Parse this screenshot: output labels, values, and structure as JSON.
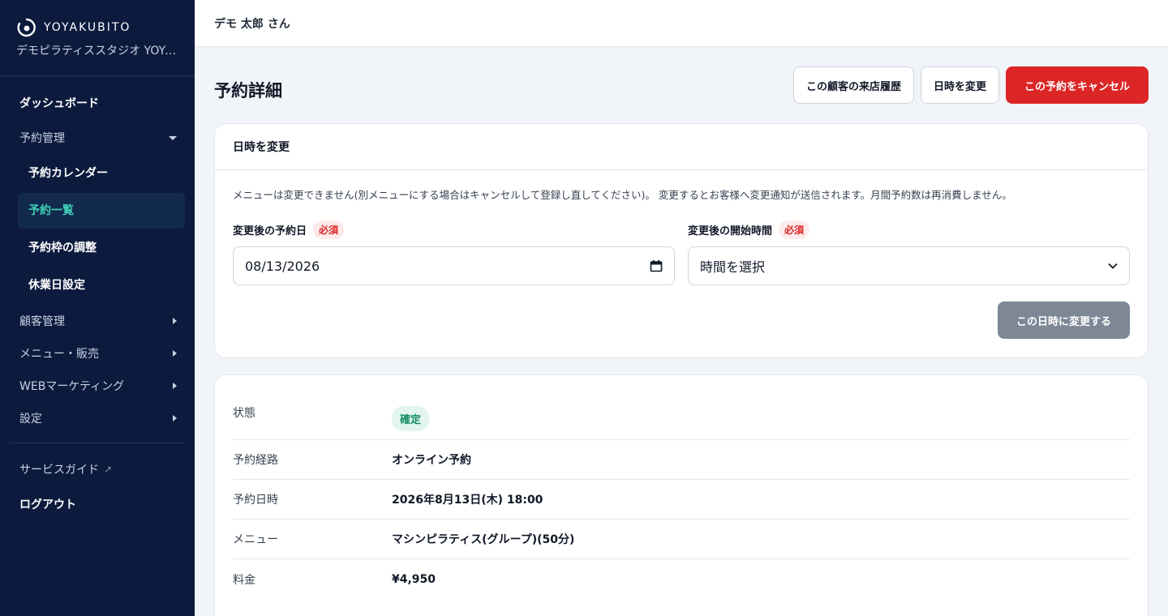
{
  "sidebar": {
    "brand_name": "YOYAKUBITO",
    "studio_name": "デモピラティススタジオ YOYAKUBITO",
    "dashboard": "ダッシュボード",
    "reservation_group": "予約管理",
    "reservation_items": [
      "予約カレンダー",
      "予約一覧",
      "予約枠の調整",
      "休業日設定"
    ],
    "groups": [
      "顧客管理",
      "メニュー・販売",
      "WEBマーケティング",
      "設定"
    ],
    "service_guide": "サービスガイド",
    "logout": "ログアウト"
  },
  "topbar": {
    "user": "デモ 太郎 さん"
  },
  "page": {
    "title": "予約詳細",
    "actions": {
      "history": "この顧客の来店履歴",
      "reschedule": "日時を変更",
      "cancel": "この予約をキャンセル"
    }
  },
  "change_form": {
    "title": "日時を変更",
    "notice": "メニューは変更できません(別メニューにする場合はキャンセルして登録し直してください)。 変更するとお客様へ変更通知が送信されます。月間予約数は再消費しません。",
    "date_label": "変更後の予約日",
    "time_label": "変更後の開始時間",
    "required": "必須",
    "date_value": "08/13/2026",
    "time_value": "時間を選択",
    "submit": "この日時に変更する"
  },
  "details": {
    "status_label": "状態",
    "status_value": "確定",
    "rows": [
      {
        "key": "予約経路",
        "value": "オンライン予約"
      },
      {
        "key": "予約日時",
        "value": "2026年8月13日(木) 18:00"
      },
      {
        "key": "メニュー",
        "value": "マシンピラティス(グループ)(50分)"
      },
      {
        "key": "料金",
        "value": "¥4,950"
      }
    ]
  },
  "colors": {
    "sidebar_bg": "#0c1a3d",
    "active_text": "#3fd2b6",
    "danger": "#dc2626",
    "success": "#0f8a5f"
  }
}
